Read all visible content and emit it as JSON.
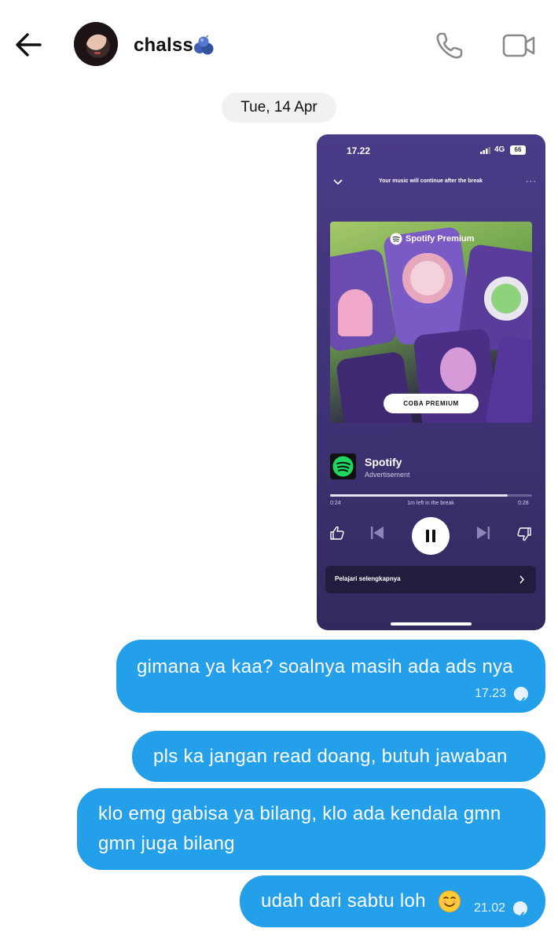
{
  "header": {
    "contact_name": "chalss",
    "icons": [
      "back-arrow-icon",
      "blueberries-emoji-icon",
      "phone-icon",
      "video-camera-icon"
    ]
  },
  "date_separator": "Tue, 14 Apr",
  "screenshot": {
    "status_time": "17.22",
    "network": "4G",
    "battery": "66",
    "banner": "Your music will continue after the break",
    "ad_brand_title": "Spotify Premium",
    "cta": "COBA PREMIUM",
    "app_name": "Spotify",
    "app_subtitle": "Advertisement",
    "progress": 0.88,
    "elapsed": "0:24",
    "remaining_text": "1m left in the break",
    "total": "0:28",
    "learn_more": "Pelajari selengkapnya",
    "colors": {
      "background": "#4a3b87",
      "spotify_green": "#1ed760"
    }
  },
  "messages": [
    {
      "text": "gimana ya kaa? soalnya masih ada ads nya",
      "time": "17.23",
      "status": "read"
    },
    {
      "text": "pls ka jangan read doang, butuh jawaban"
    },
    {
      "text": "klo emg gabisa ya bilang, klo ada kendala gmn gmn juga bilang"
    },
    {
      "text": "udah dari sabtu loh",
      "emoji": "smiling-face-icon",
      "time": "21.02",
      "status": "read"
    }
  ],
  "colors": {
    "bubble": "#249fe9",
    "date_pill": "#f1f1f1"
  }
}
